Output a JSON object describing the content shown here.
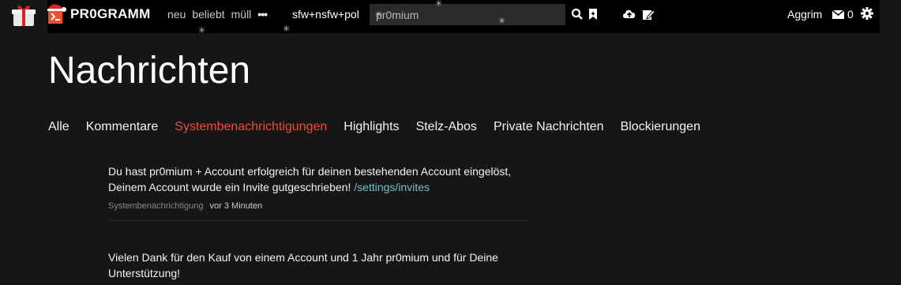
{
  "header": {
    "logo_text": "PR0GRAMM",
    "nav": [
      "neu",
      "beliebt",
      "müll"
    ],
    "more": "•••",
    "filter": "sfw+nsfw+pol",
    "search_value": "pr0mium",
    "user": "Aggrim",
    "inbox_count": "0",
    "icons": [
      "gift-icon",
      "logo-icon",
      "search-icon",
      "bookmark-icon",
      "upload-icon",
      "edit-icon",
      "mail-icon",
      "gear-icon"
    ]
  },
  "page": {
    "title": "Nachrichten",
    "tabs": [
      "Alle",
      "Kommentare",
      "Systembenachrichtigungen",
      "Highlights",
      "Stelz-Abos",
      "Private Nachrichten",
      "Blockierungen"
    ],
    "active_tab": "Systembenachrichtigungen"
  },
  "messages": [
    {
      "text_line1": "Du hast pr0mium + Account erfolgreich für deinen bestehenden Account eingelöst,",
      "text_line2": "Deinem Account wurde ein Invite gutgeschrieben!",
      "link": "/settings/invites",
      "category": "Systembenachrichtigung",
      "time": "vor 3 Minuten"
    },
    {
      "text_line1": "Vielen Dank für den Kauf von einem Account und 1 Jahr pr0mium und für Deine",
      "text_line2": "Unterstützung!"
    }
  ],
  "colors": {
    "accent": "#ee4d2e",
    "link": "#75c0c7",
    "background": "#161618",
    "topbar": "#000000"
  }
}
